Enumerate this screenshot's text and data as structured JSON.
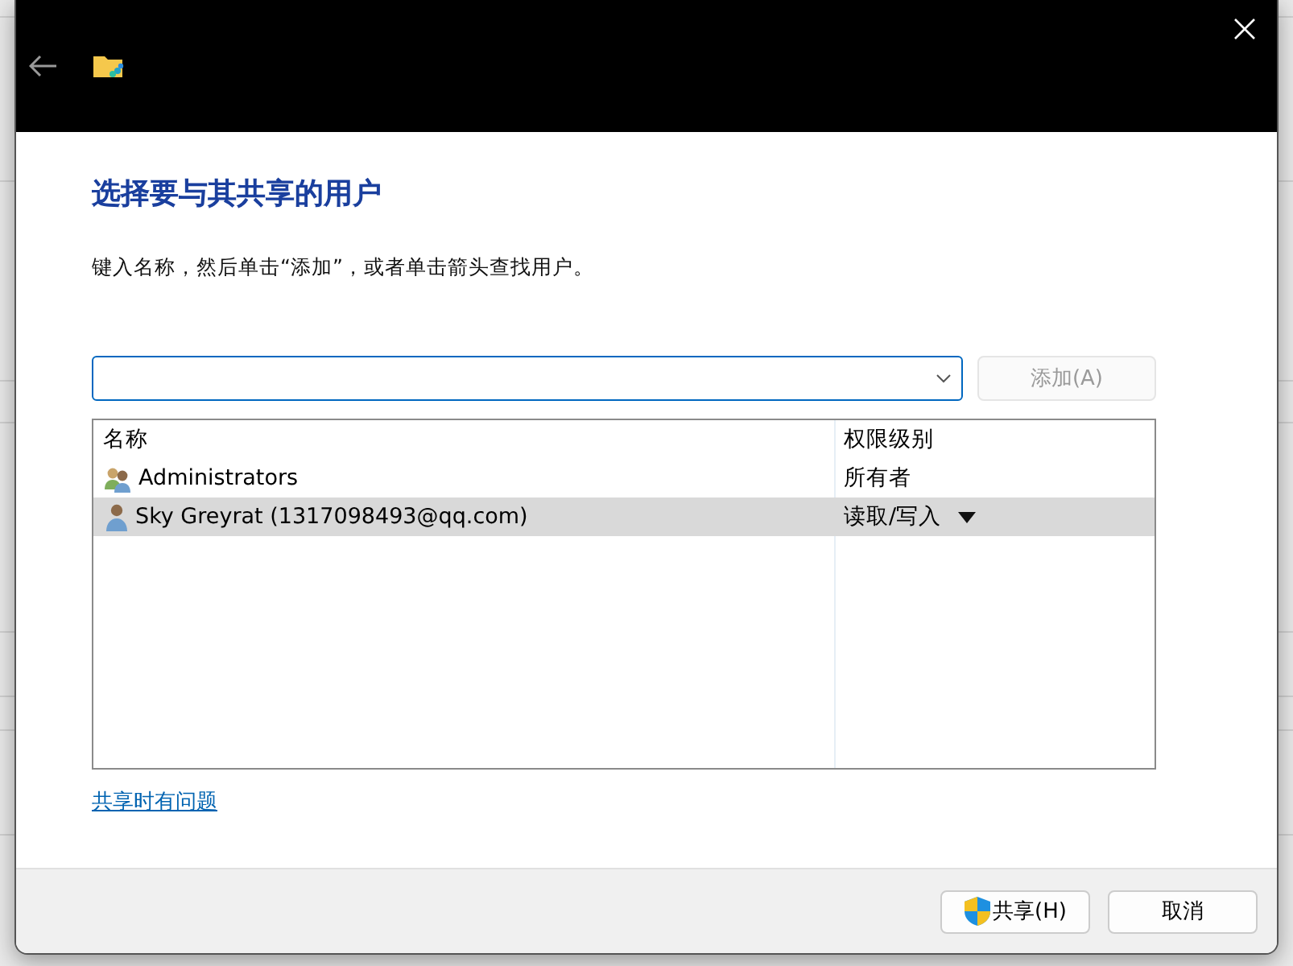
{
  "heading": "选择要与其共享的用户",
  "instruction": "键入名称，然后单击“添加”，或者单击箭头查找用户。",
  "add_button": {
    "label": "添加(A)",
    "disabled": true
  },
  "table": {
    "columns": [
      "名称",
      "权限级别"
    ],
    "rows": [
      {
        "kind": "group",
        "name": "Administrators",
        "permission": "所有者",
        "has_menu": false,
        "selected": false
      },
      {
        "kind": "user",
        "name": "Sky Greyrat (1317098493@qq.com)",
        "permission": "读取/写入",
        "has_menu": true,
        "selected": true
      }
    ]
  },
  "help_link": "共享时有问题",
  "buttons": [
    {
      "kind": "shield",
      "label": "共享(H)"
    },
    {
      "kind": "plain",
      "label": "取消"
    }
  ]
}
